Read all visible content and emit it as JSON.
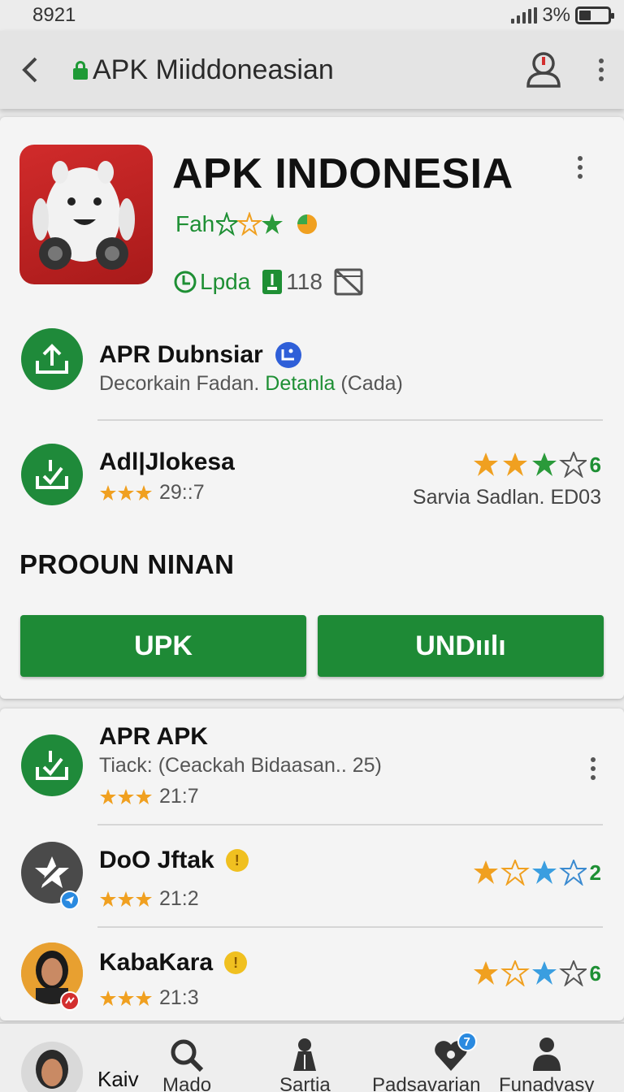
{
  "status": {
    "time": "8921",
    "battery": "3%"
  },
  "appbar": {
    "title": "APK Miiddoneasian"
  },
  "hero": {
    "title": "APK INDONESIA",
    "subtitle": "Fah",
    "meta_update": "Lpda",
    "meta_count": "118"
  },
  "rows": [
    {
      "title": "APR Dubnsiar",
      "sub_a": "Decorkain Fadan.",
      "sub_link": "Detanla",
      "sub_b": "(Cada)"
    },
    {
      "title": "Adl|Jlokesa",
      "rating": "29::7",
      "right_count": "6",
      "right_text": "Sarvia Sadlan. ED03"
    }
  ],
  "section": {
    "title": "PROOUN NINAN"
  },
  "buttons": {
    "left": "UPK",
    "right": "UNDıılı"
  },
  "list": [
    {
      "title": "APR APK",
      "sub": "Tiack: (Ceackah Bidaasan.. 25)",
      "rating": "21:7"
    },
    {
      "title": "DoO Jftak",
      "rating": "21:2",
      "right_count": "2"
    },
    {
      "title": "KabaKara",
      "rating": "21:3",
      "right_count": "6"
    }
  ],
  "nav": {
    "profile": "Kaiv",
    "items": [
      "Mado",
      "Sartia",
      "Padsavarian",
      "Funadvasy"
    ],
    "badge": "7"
  },
  "colors": {
    "accent": "#1e8a36",
    "star": "#f0a020",
    "brand_red": "#c62828",
    "star_blue": "#3a9ee0"
  }
}
